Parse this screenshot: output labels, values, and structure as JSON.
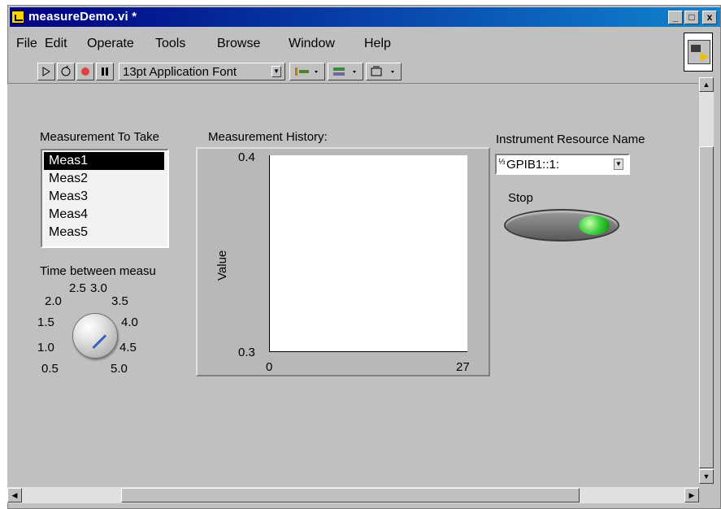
{
  "window": {
    "title": "measureDemo.vi *",
    "controls": {
      "minimize": "_",
      "maximize": "□",
      "close": "x"
    }
  },
  "menubar": {
    "items": [
      {
        "label": "File",
        "mnemonic": "F"
      },
      {
        "label": "Edit",
        "mnemonic": "E"
      },
      {
        "label": "Operate",
        "mnemonic": "O"
      },
      {
        "label": "Tools",
        "mnemonic": "T"
      },
      {
        "label": "Browse",
        "mnemonic": "B"
      },
      {
        "label": "Window",
        "mnemonic": "W"
      },
      {
        "label": "Help",
        "mnemonic": "H"
      }
    ]
  },
  "toolbar": {
    "font_select": "13pt Application Font"
  },
  "measurement_list": {
    "label": "Measurement To Take",
    "items": [
      "Meas1",
      "Meas2",
      "Meas3",
      "Meas4",
      "Meas5"
    ],
    "selected": "Meas1"
  },
  "knob": {
    "label": "Time between measu",
    "ticks": [
      "0.5",
      "1.0",
      "1.5",
      "2.0",
      "2.5",
      "3.0",
      "3.5",
      "4.0",
      "4.5",
      "5.0"
    ],
    "value": 0.5
  },
  "graph": {
    "label": "Measurement History:",
    "ylabel": "Value",
    "y_ticks": [
      "0.4",
      "0.3"
    ],
    "x_ticks": [
      "0",
      "27"
    ],
    "ylim": [
      0.3,
      0.4
    ],
    "xlim": [
      0,
      27
    ]
  },
  "resource": {
    "label": "Instrument Resource Name",
    "value": "GPIB1::1:"
  },
  "stop": {
    "label": "Stop"
  },
  "colors": {
    "title_bar": "#000080",
    "panel": "#c0c0c0",
    "stop_led": "#40d040"
  }
}
